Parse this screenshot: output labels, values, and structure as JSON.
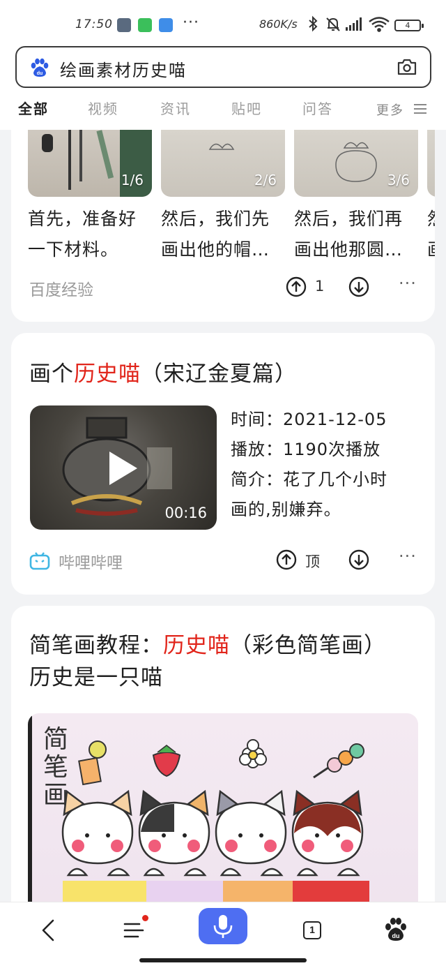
{
  "status_bar": {
    "time": "17:50",
    "more": "···",
    "net_speed": "860K/s",
    "battery": "4"
  },
  "search": {
    "query": "绘画素材历史喵"
  },
  "tabs": [
    {
      "label": "全部"
    },
    {
      "label": "视频"
    },
    {
      "label": "资讯"
    },
    {
      "label": "贴吧"
    },
    {
      "label": "问答"
    },
    {
      "label": "更多"
    }
  ],
  "card1": {
    "steps": [
      {
        "count": "1/6",
        "text_line1": "首先，准备好",
        "text_line2": "一下材料。"
      },
      {
        "count": "2/6",
        "text_line1": "然后，我们先",
        "text_line2": "画出他的帽…"
      },
      {
        "count": "3/6",
        "text_line1": "然后，我们再",
        "text_line2": "画出他那圆…"
      },
      {
        "count": "",
        "text_line1": "然",
        "text_line2": "画"
      }
    ],
    "source": "百度经验",
    "upvotes": "1",
    "more": "···"
  },
  "card2": {
    "title_pre": "画个",
    "title_highlight": "历史喵",
    "title_post": "（宋辽金夏篇）",
    "duration": "00:16",
    "time_line": "时间：2021-12-05",
    "plays_line": "播放：1190次播放",
    "intro_line1": "简介：花了几个小时",
    "intro_line2": "画的,别嫌弃。",
    "source": "哔哩哔哩",
    "upvote_label": "顶",
    "more": "···"
  },
  "card3": {
    "title_pre": "简笔画教程：",
    "title_highlight": "历史喵",
    "title_post": "（彩色简笔画）",
    "title_line2": "历史是一只喵",
    "image_title": "简笔画"
  },
  "bottom_nav": {
    "tab_count": "1"
  },
  "colors": {
    "accent": "#4e6ef2",
    "highlight": "#e1251b",
    "muted": "#9b9b9b"
  }
}
